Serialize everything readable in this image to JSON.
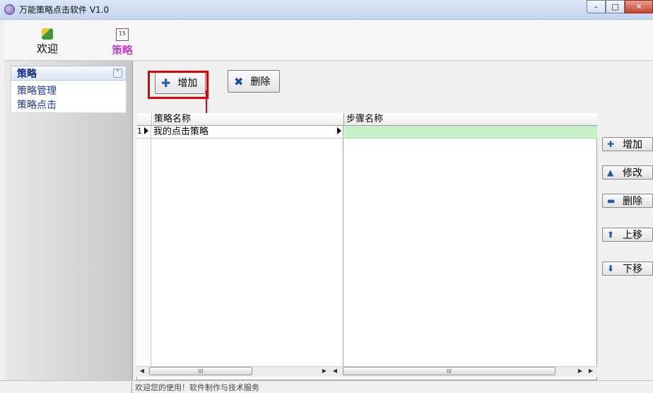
{
  "window": {
    "title": "万能策略点击软件 V1.0",
    "minimize": "–",
    "maximize": "□",
    "close": "✕"
  },
  "ribbon": {
    "tabs": [
      {
        "label": "欢迎",
        "icon": "welcome-icon"
      },
      {
        "label": "策略",
        "icon": "calendar-icon",
        "selected": true
      }
    ]
  },
  "sidebar": {
    "header": "策略",
    "collapse_glyph": "⌃",
    "items": [
      "策略管理",
      "策略点击"
    ]
  },
  "toolbar": {
    "add_label": "增加",
    "delete_label": "删除"
  },
  "grid": {
    "columns": [
      "策略名称",
      "步骤名称"
    ],
    "rows": [
      {
        "num": "1",
        "name": "我的点击策略"
      }
    ]
  },
  "side_buttons": {
    "add": "增加",
    "edit": "修改",
    "delete": "删除",
    "up": "上移",
    "down": "下移"
  },
  "scrollbar": {
    "thumb_grip": "III"
  },
  "status": {
    "message": "欢迎您的使用！软件制作与技术服务"
  },
  "colors": {
    "highlight": "#e00000",
    "selected_row": "#c8f0c8",
    "accent_tab": "#c000c0"
  }
}
